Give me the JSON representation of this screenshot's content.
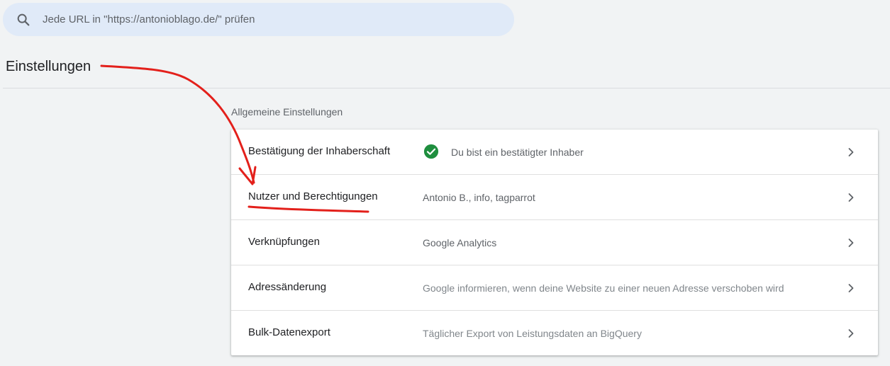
{
  "search": {
    "placeholder": "Jede URL in \"https://antonioblago.de/\" prüfen"
  },
  "page": {
    "title": "Einstellungen"
  },
  "section": {
    "title": "Allgemeine Einstellungen",
    "rows": [
      {
        "label": "Bestätigung der Inhaberschaft",
        "value": "Du bist ein bestätigter Inhaber"
      },
      {
        "label": "Nutzer und Berechtigungen",
        "value": "Antonio B., info, tagparrot"
      },
      {
        "label": "Verknüpfungen",
        "value": "Google Analytics"
      },
      {
        "label": "Adressänderung",
        "value": "Google informieren, wenn deine Website zu einer neuen Adresse verschoben wird"
      },
      {
        "label": "Bulk-Datenexport",
        "value": "Täglicher Export von Leistungsdaten an BigQuery"
      }
    ]
  },
  "icons": {
    "search": "search-icon",
    "verified": "check-circle-icon",
    "chevron": "chevron-right-icon"
  },
  "colors": {
    "background": "#f1f3f4",
    "search_bar": "#e0eaf8",
    "verified_green": "#1e8e3e",
    "annotation_red": "#e3201b"
  }
}
